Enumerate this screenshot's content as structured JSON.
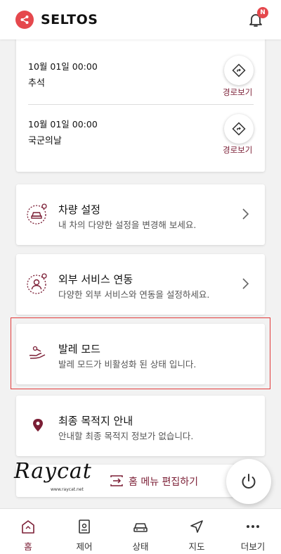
{
  "header": {
    "title": "SELTOS",
    "notification_badge": "N"
  },
  "events": [
    {
      "date": "10월 01일 00:00",
      "name": "추석",
      "route_label": "경로보기"
    },
    {
      "date": "10월 01일 00:00",
      "name": "국군의날",
      "route_label": "경로보기"
    }
  ],
  "menus": [
    {
      "title": "차량 설정",
      "desc": "내 차의 다양한 설정을 변경해 보세요.",
      "icon": "car-settings-icon"
    },
    {
      "title": "외부 서비스 연동",
      "desc": "다양한 외부 서비스와 연동을 설정하세요.",
      "icon": "user-settings-icon"
    },
    {
      "title": "발레 모드",
      "desc": "발레 모드가 비활성화 된 상태 입니다.",
      "icon": "valet-hand-icon"
    },
    {
      "title": "최종 목적지 안내",
      "desc": "안내할 최종 목적지 정보가 없습니다.",
      "icon": "location-pin-icon"
    }
  ],
  "edit_bar": {
    "label": "홈 메뉴 편집하기"
  },
  "watermark": {
    "text": "Raycat",
    "url": "www.raycat.net"
  },
  "tabs": [
    {
      "label": "홈",
      "active": true
    },
    {
      "label": "제어"
    },
    {
      "label": "상태"
    },
    {
      "label": "지도"
    },
    {
      "label": "더보기"
    }
  ],
  "colors": {
    "accent": "#7b1e35",
    "brand_red": "#e5484d",
    "highlight_border": "#e23b3b"
  }
}
